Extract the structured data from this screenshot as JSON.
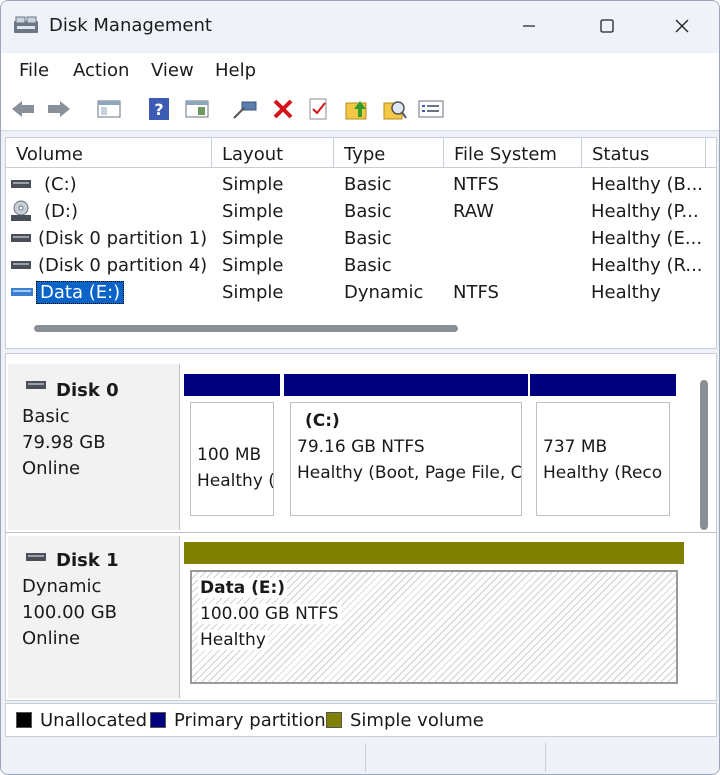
{
  "window": {
    "title": "Disk Management"
  },
  "menu": {
    "file": "File",
    "action": "Action",
    "view": "View",
    "help": "Help"
  },
  "columns": {
    "volume": "Volume",
    "layout": "Layout",
    "type": "Type",
    "file_system": "File System",
    "status": "Status"
  },
  "volumes": [
    {
      "name": "(C:)",
      "layout": "Simple",
      "type": "Basic",
      "fs": "NTFS",
      "status": "Healthy (B..."
    },
    {
      "name": "(D:)",
      "layout": "Simple",
      "type": "Basic",
      "fs": "RAW",
      "status": "Healthy (P..."
    },
    {
      "name": "(Disk 0 partition 1)",
      "layout": "Simple",
      "type": "Basic",
      "fs": "",
      "status": "Healthy (E..."
    },
    {
      "name": "(Disk 0 partition 4)",
      "layout": "Simple",
      "type": "Basic",
      "fs": "",
      "status": "Healthy (R..."
    },
    {
      "name": "Data (E:)",
      "layout": "Simple",
      "type": "Dynamic",
      "fs": "NTFS",
      "status": "Healthy"
    }
  ],
  "disks": [
    {
      "name": "Disk 0",
      "type": "Basic",
      "size": "79.98 GB",
      "state": "Online",
      "partitions": [
        {
          "label": "",
          "size": "100 MB",
          "status": "Healthy ("
        },
        {
          "label": "(C:)",
          "size": "79.16 GB NTFS",
          "status": "Healthy (Boot, Page File, C"
        },
        {
          "label": "",
          "size": "737 MB",
          "status": "Healthy (Reco"
        }
      ]
    },
    {
      "name": "Disk 1",
      "type": "Dynamic",
      "size": "100.00 GB",
      "state": "Online",
      "partitions": [
        {
          "label": "Data  (E:)",
          "size": "100.00 GB NTFS",
          "status": "Healthy"
        }
      ]
    }
  ],
  "legend": {
    "unallocated": "Unallocated",
    "primary": "Primary partition",
    "simple": "Simple volume"
  },
  "colors": {
    "primary": "#00007f",
    "simple": "#7f7f00",
    "unallocated": "#000000",
    "selection": "#0a64c8"
  },
  "icons": [
    "app-icon",
    "minimize-icon",
    "maximize-icon",
    "close-icon",
    "back-icon",
    "forward-icon",
    "properties-pane-icon",
    "help-icon",
    "show-pane-icon",
    "connect-icon",
    "delete-icon",
    "check-icon",
    "up-folder-icon",
    "search-icon",
    "list-icon",
    "drive-icon",
    "cd-drive-icon"
  ]
}
